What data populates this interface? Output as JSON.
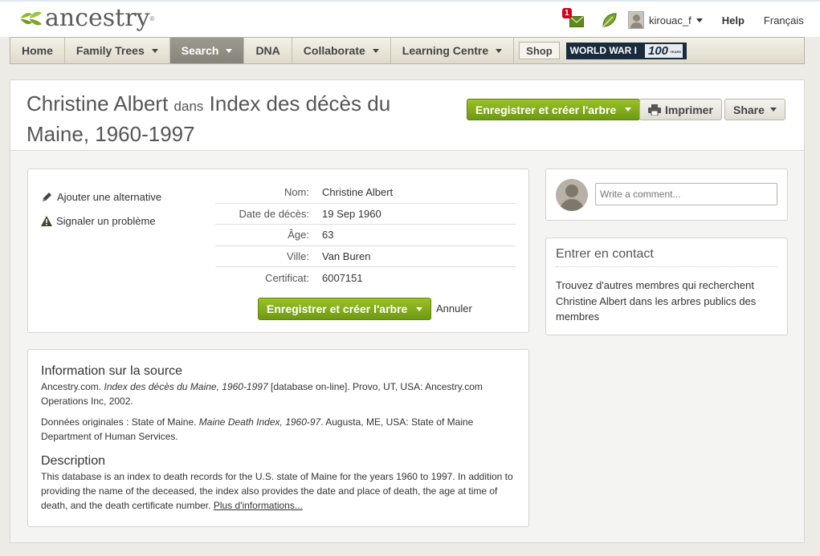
{
  "brand": {
    "logo_text": "ancestry",
    "trademark": "®"
  },
  "top": {
    "message_count": "1",
    "username": "kirouac_f",
    "help": "Help",
    "language": "Français"
  },
  "nav": {
    "home": "Home",
    "family_trees": "Family Trees",
    "search": "Search",
    "dna": "DNA",
    "collaborate": "Collaborate",
    "learning_centre": "Learning Centre",
    "shop": "Shop",
    "ww1_text": "WORLD WAR I",
    "ww1_100": "100",
    "ww1_years": "YEARS"
  },
  "record": {
    "name": "Christine Albert",
    "in_word": "dans",
    "collection": "Index des décès du Maine, 1960-1997",
    "save_button": "Enregistrer et créer l'arbre",
    "print_button": "Imprimer",
    "share_button": "Share",
    "add_alternative": "Ajouter une alternative",
    "report_problem": "Signaler un problème",
    "fields": [
      {
        "label": "Nom:",
        "value": "Christine Albert"
      },
      {
        "label": "Date de décès:",
        "value": "19 Sep 1960"
      },
      {
        "label": "Âge:",
        "value": "63"
      },
      {
        "label": "Ville:",
        "value": "Van Buren"
      },
      {
        "label": "Certificat:",
        "value": "6007151"
      }
    ],
    "cancel": "Annuler"
  },
  "source": {
    "heading": "Information sur la source",
    "citation_pre": "Ancestry.com.",
    "citation_title": "Index des décès du Maine, 1960-1997",
    "citation_post": "[database on-line]. Provo, UT, USA: Ancestry.com Operations Inc, 2002.",
    "original_pre": "Données originales : State of Maine.",
    "original_title": "Maine Death Index, 1960-97",
    "original_post": ". Augusta, ME, USA: State of Maine Department of Human Services.",
    "desc_heading": "Description",
    "description": "This database is an index to death records for the U.S. state of Maine for the years 1960 to 1997. In addition to providing the name of the deceased, the index also provides the date and place of death, the age at time of death, and the death certificate number.",
    "more_link": "Plus d'informations..."
  },
  "sidebar": {
    "comment_placeholder": "Write a comment...",
    "contact_heading": "Entrer en contact",
    "contact_text": "Trouvez d'autres membres qui recherchent Christine Albert dans les arbres publics des membres"
  },
  "colors": {
    "green_button": "#7fa91b",
    "nav_active": "#908d84",
    "ww1_bg": "#1b2b3f",
    "badge": "#d0021b"
  }
}
